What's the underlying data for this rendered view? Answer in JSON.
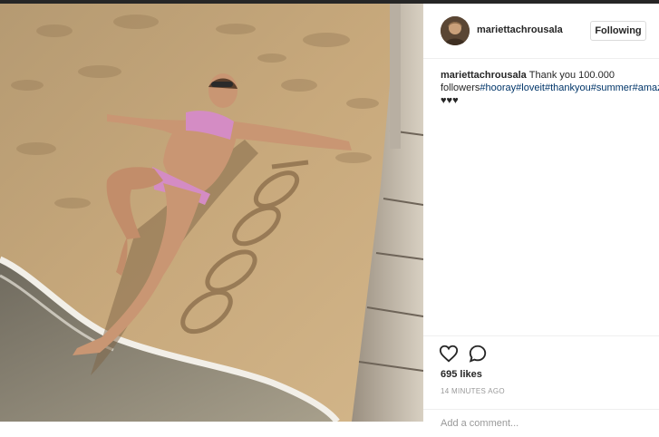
{
  "post": {
    "username": "mariettachrousala",
    "follow_label": "Following",
    "caption_user": "mariettachrousala",
    "caption_text": "Thank you 100.000 followers",
    "tags": [
      "#hooray",
      "#loveit",
      "#thankyou",
      "#summer",
      "#amazing"
    ],
    "hearts": "♥♥♥",
    "likes": "695 likes",
    "time": "14 MINUTES AGO",
    "comment_placeholder": "Add a comment..."
  },
  "icons": {
    "like": "heart-outline-icon",
    "comment": "speech-bubble-icon"
  },
  "colors": {
    "hashtag": "#003569",
    "border": "#efefef",
    "muted": "#999999"
  }
}
